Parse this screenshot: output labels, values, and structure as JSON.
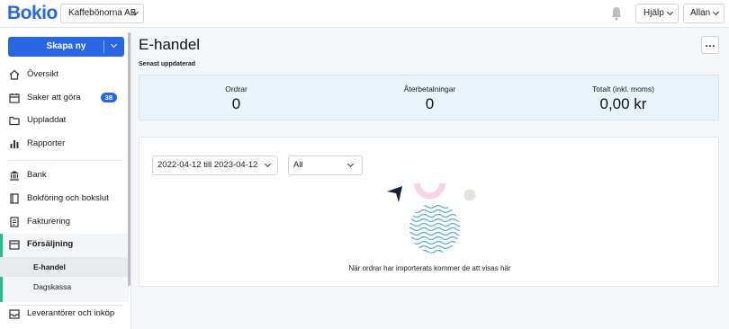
{
  "header": {
    "logo": "Bokio",
    "company": "Kaffebönorna AB",
    "help": "Hjälp",
    "user": "Allan"
  },
  "sidebar": {
    "create_label": "Skapa ny",
    "items": [
      {
        "label": "Översikt",
        "icon": "home-icon"
      },
      {
        "label": "Saker att göra",
        "icon": "calendar-icon",
        "badge": "38"
      },
      {
        "label": "Uppladdat",
        "icon": "folder-icon"
      },
      {
        "label": "Rapporter",
        "icon": "bar-chart-icon"
      },
      {
        "label": "Bank",
        "icon": "bank-icon"
      },
      {
        "label": "Bokföring och bokslut",
        "icon": "book-icon"
      },
      {
        "label": "Fakturering",
        "icon": "invoice-icon"
      },
      {
        "label": "Försäljning",
        "icon": "store-icon"
      },
      {
        "label": "Leverantörer och inköp",
        "icon": "inbox-icon"
      }
    ],
    "sub_items": [
      "E-handel",
      "Dagskassa"
    ]
  },
  "main": {
    "title": "E-handel",
    "updated_label": "Senast uppdaterad",
    "stats": [
      {
        "label": "Ordrar",
        "value": "0"
      },
      {
        "label": "Återbetalningar",
        "value": "0"
      },
      {
        "label": "Totalt (inkl. moms)",
        "value": "0,00 kr"
      }
    ],
    "date_range": "2022-04-12 till 2023-04-12",
    "filter": "All",
    "empty_message": "När ordrar har importerats kommer de att visas här"
  },
  "colors": {
    "brand": "#2966e4",
    "active_accent": "#1fbf8f"
  }
}
